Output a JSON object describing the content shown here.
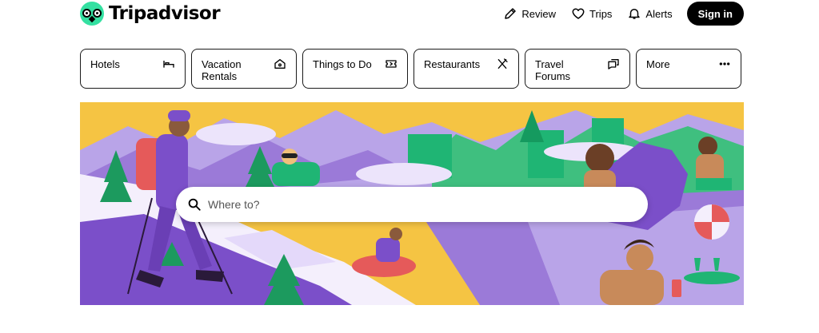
{
  "header": {
    "logo_text": "Tripadvisor",
    "links": [
      {
        "label": "Review",
        "icon": "pencil-icon"
      },
      {
        "label": "Trips",
        "icon": "heart-icon"
      },
      {
        "label": "Alerts",
        "icon": "bell-icon"
      }
    ],
    "signin_label": "Sign in"
  },
  "categories": [
    {
      "label": "Hotels",
      "icon": "bed-icon"
    },
    {
      "label": "Vacation Rentals",
      "icon": "house-icon"
    },
    {
      "label": "Things to Do",
      "icon": "ticket-icon"
    },
    {
      "label": "Restaurants",
      "icon": "fork-knife-icon"
    },
    {
      "label": "Travel Forums",
      "icon": "chat-bubbles-icon"
    },
    {
      "label": "More",
      "icon": "more-dots-icon"
    }
  ],
  "search": {
    "placeholder": "Where to?",
    "icon": "search-icon"
  },
  "colors": {
    "brand_green": "#34e0a1",
    "hero_yellow": "#f5c443",
    "hero_purple": "#7b4fc9",
    "hero_green": "#1fb574"
  }
}
